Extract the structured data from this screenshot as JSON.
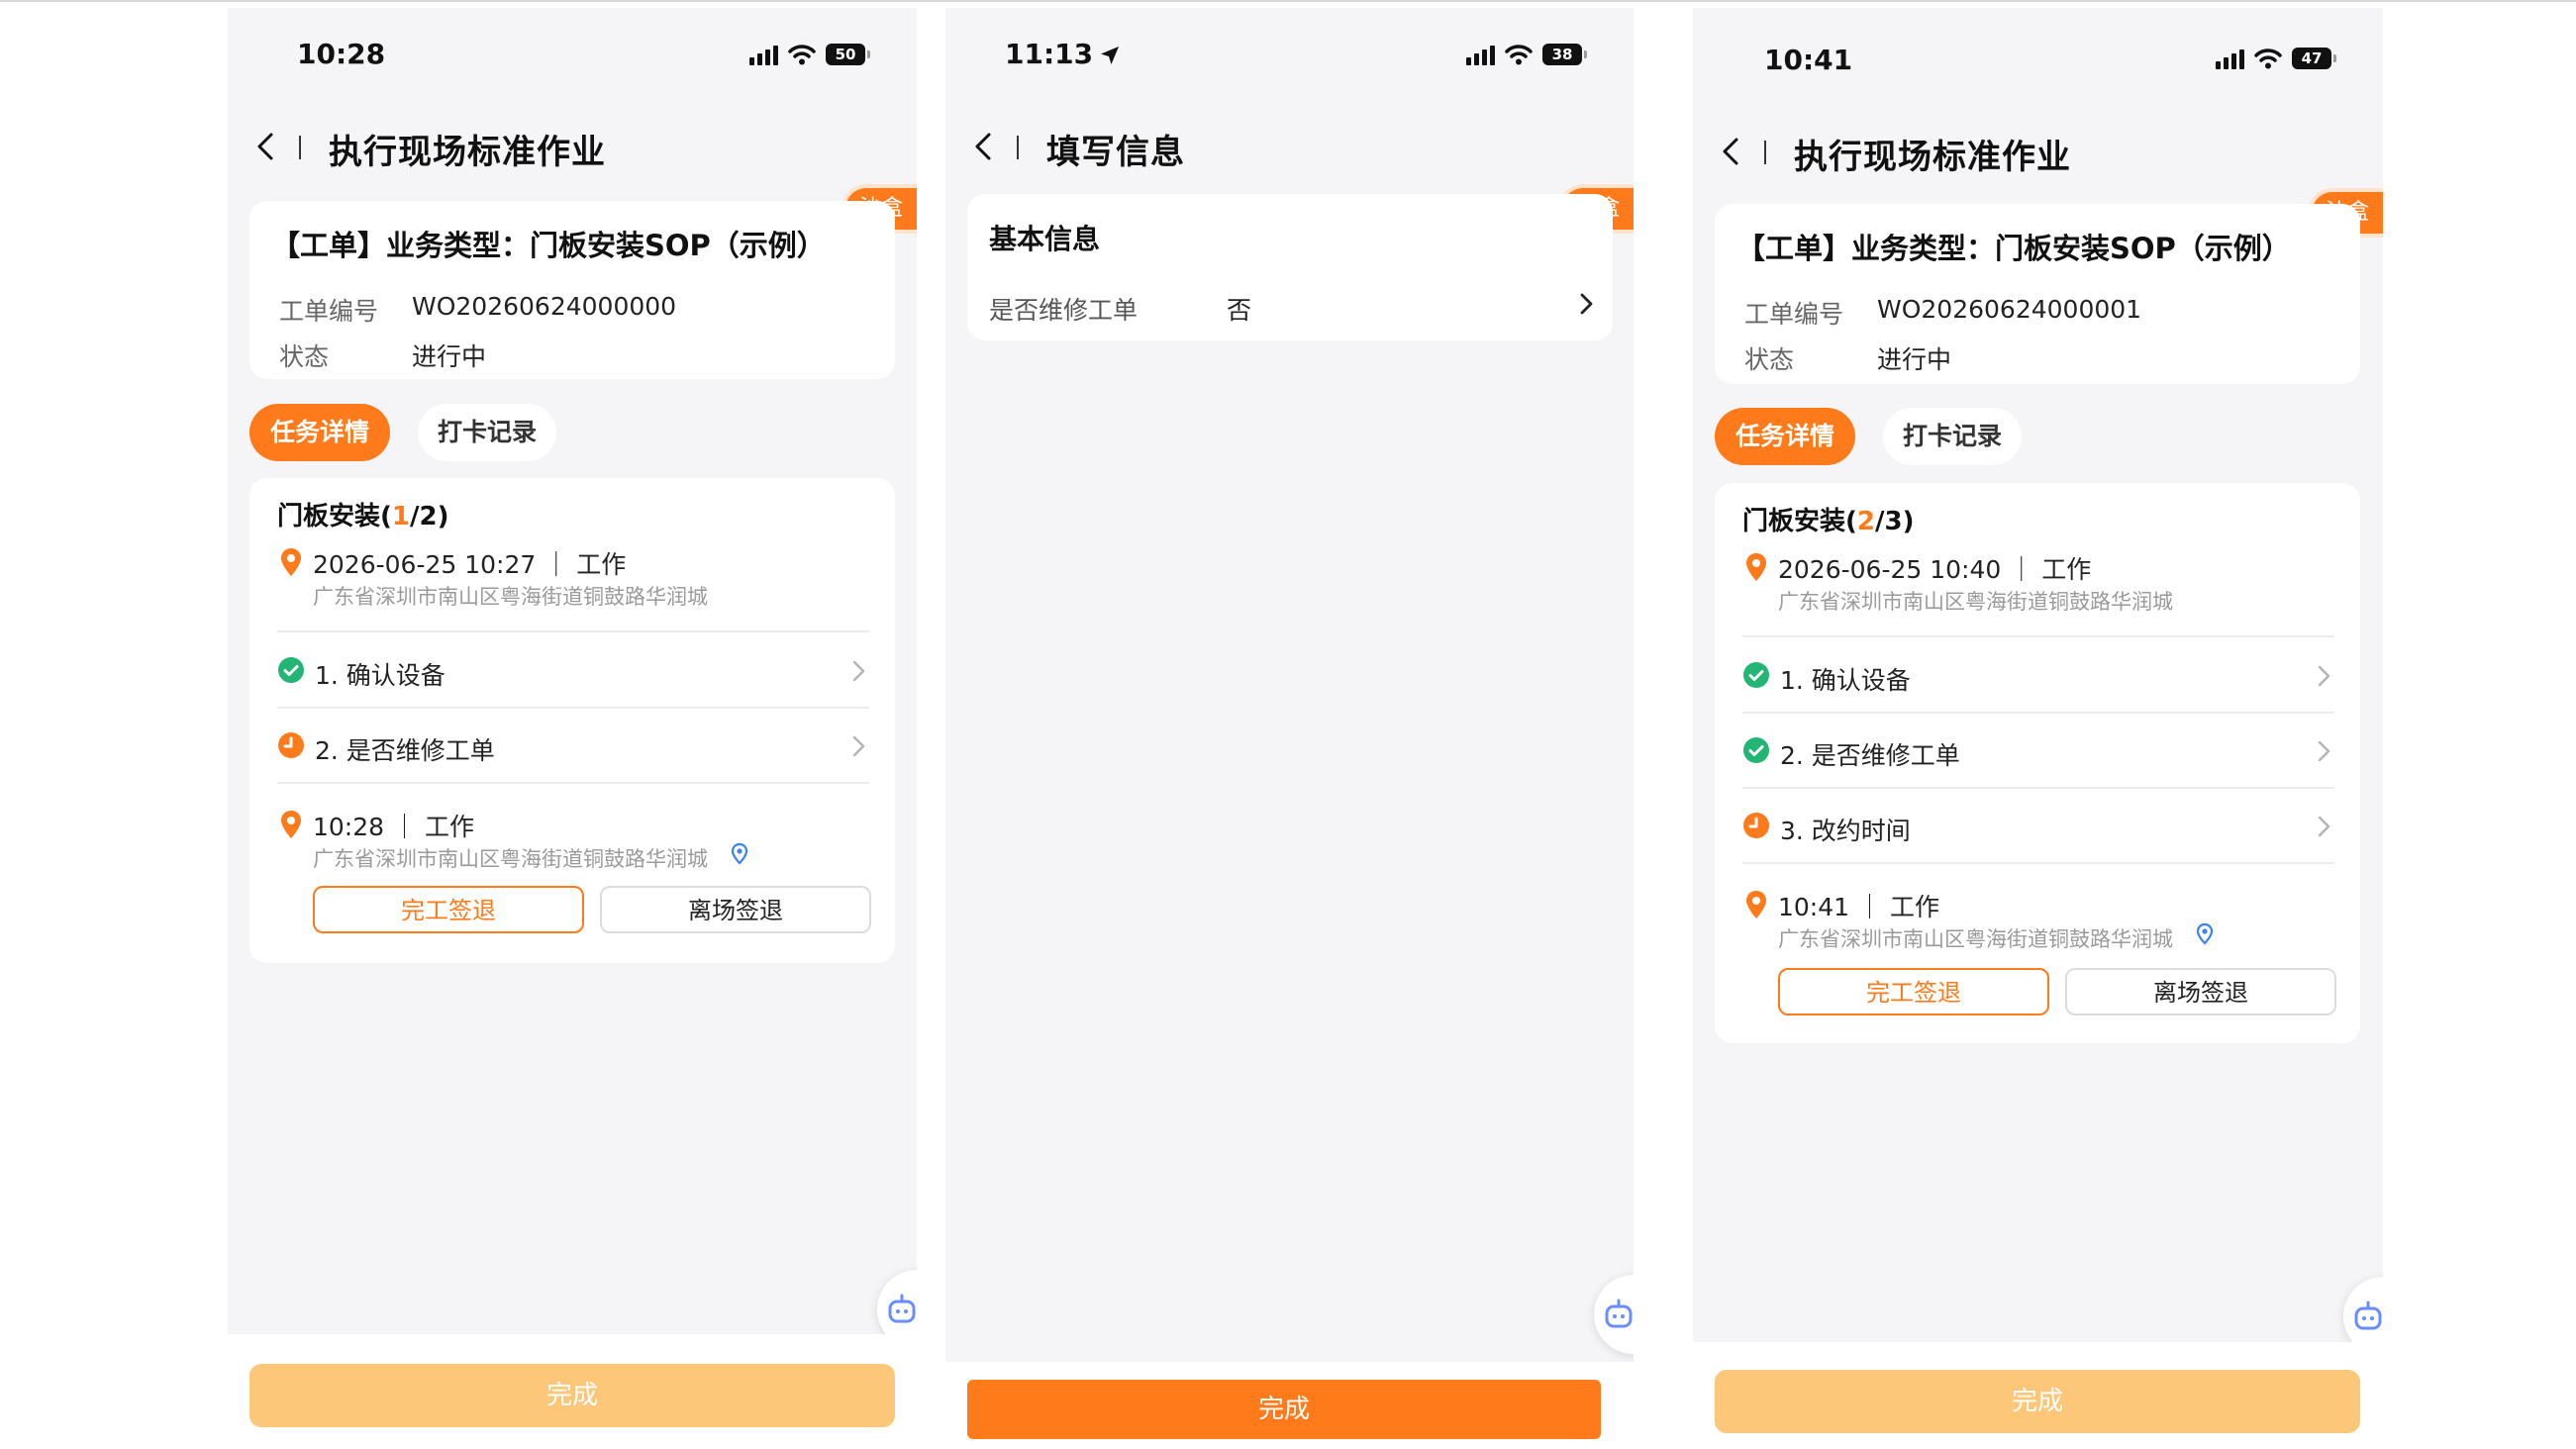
{
  "colors": {
    "accent": "#ff7a1a",
    "accent_disabled": "#fdc779",
    "success": "#22b573",
    "page_bg": "#f5f5f7"
  },
  "phone1": {
    "status": {
      "time": "10:28",
      "battery": "50"
    },
    "header": {
      "title": "执行现场标准作业"
    },
    "sandbox": "沙盒",
    "order": {
      "title": "【工单】业务类型：门板安装SOP（示例）",
      "number_label": "工单编号",
      "number": "WO20260624000000",
      "status_label": "状态",
      "status": "进行中"
    },
    "tabs": {
      "detail": "任务详情",
      "record": "打卡记录"
    },
    "task": {
      "name": "门板安装(",
      "current": "1",
      "total": "/2)",
      "checkin": {
        "time": "2026-06-25 10:27",
        "type": "工作",
        "address": "广东省深圳市南山区粤海街道铜鼓路华润城"
      },
      "steps": [
        {
          "label": "1. 确认设备",
          "status": "done"
        },
        {
          "label": "2. 是否维修工单",
          "status": "pending"
        }
      ],
      "checkout": {
        "time": "10:28",
        "type": "工作",
        "address": "广东省深圳市南山区粤海街道铜鼓路华润城"
      },
      "finish_label": "完工签退",
      "leave_label": "离场签退"
    },
    "done_label": "完成"
  },
  "phone2": {
    "status": {
      "time": "11:13",
      "battery": "38"
    },
    "header": {
      "title": "填写信息"
    },
    "sandbox": "沙盒",
    "section_title": "基本信息",
    "field": {
      "label": "是否维修工单",
      "value": "否"
    },
    "done_label": "完成"
  },
  "phone3": {
    "status": {
      "time": "10:41",
      "battery": "47"
    },
    "header": {
      "title": "执行现场标准作业"
    },
    "sandbox": "沙盒",
    "order": {
      "title": "【工单】业务类型：门板安装SOP（示例）",
      "number_label": "工单编号",
      "number": "WO20260624000001",
      "status_label": "状态",
      "status": "进行中"
    },
    "tabs": {
      "detail": "任务详情",
      "record": "打卡记录"
    },
    "task": {
      "name": "门板安装(",
      "current": "2",
      "total": "/3)",
      "checkin": {
        "time": "2026-06-25 10:40",
        "type": "工作",
        "address": "广东省深圳市南山区粤海街道铜鼓路华润城"
      },
      "steps": [
        {
          "label": "1. 确认设备",
          "status": "done"
        },
        {
          "label": "2. 是否维修工单",
          "status": "done"
        },
        {
          "label": "3. 改约时间",
          "status": "pending"
        }
      ],
      "checkout": {
        "time": "10:41",
        "type": "工作",
        "address": "广东省深圳市南山区粤海街道铜鼓路华润城"
      },
      "finish_label": "完工签退",
      "leave_label": "离场签退"
    },
    "done_label": "完成"
  },
  "icons": [
    "back-icon",
    "signal-icon",
    "wifi-icon",
    "battery-icon",
    "location-arrow-icon",
    "location-pin-icon",
    "check-circle-icon",
    "clock-icon",
    "chevron-right-icon",
    "map-marker-icon",
    "assistant-bot-icon"
  ]
}
